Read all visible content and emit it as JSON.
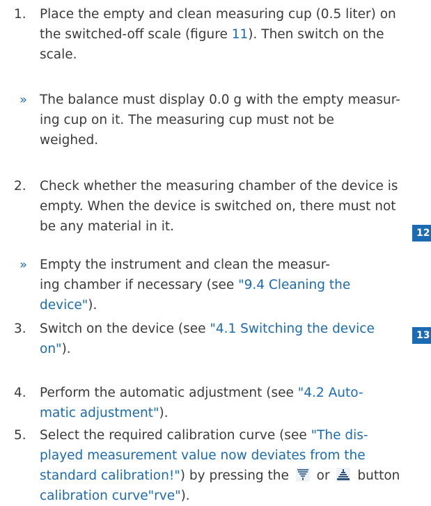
{
  "steps": [
    {
      "num": "1.",
      "lines": [
        "Place the empty and clean measuring cup (0.5 liter) on",
        "the switched-off scale (figure ",
        "11",
        "). Then switch on the",
        "scale."
      ]
    },
    {
      "bullet": "»",
      "lines": [
        "The balance must display 0.0 g with the empty measur-",
        "ing cup on it. The measuring cup must not be",
        "weighed."
      ]
    },
    {
      "num": "2.",
      "lines": [
        "Check whether the measuring chamber of the device is",
        "empty. When the device is switched on, there must not",
        "be any material in it."
      ]
    },
    {
      "bullet": "»",
      "lines": [
        "Empty the instrument and clean the measur-",
        "ing chamber if necessary (see ",
        "\"9.4 Cleaning the",
        "device\"",
        ")."
      ]
    },
    {
      "num": "3.",
      "lines": [
        "Switch on the device (see ",
        "\"4.1 Switching the device",
        "on\"",
        ")."
      ]
    },
    {
      "num": "4.",
      "lines": [
        "Perform the automatic adjustment (see ",
        "\"4.2 Auto-",
        "matic adjustment\"",
        ")."
      ]
    },
    {
      "num": "5.",
      "lines": [
        "Select the required calibration curve (see ",
        "\"The dis-",
        "played measurement value now deviates from the",
        "standard calibration!\"",
        ") by pressing the ",
        " or ",
        " button",
        "calibration curve\"rve\"",
        ")."
      ]
    }
  ],
  "markers": [
    "12",
    "13"
  ],
  "icons": {
    "down": "calibration-down-icon",
    "up": "calibration-up-icon"
  },
  "colors": {
    "link": "#1a6bb3",
    "text": "#3a3a3a"
  }
}
